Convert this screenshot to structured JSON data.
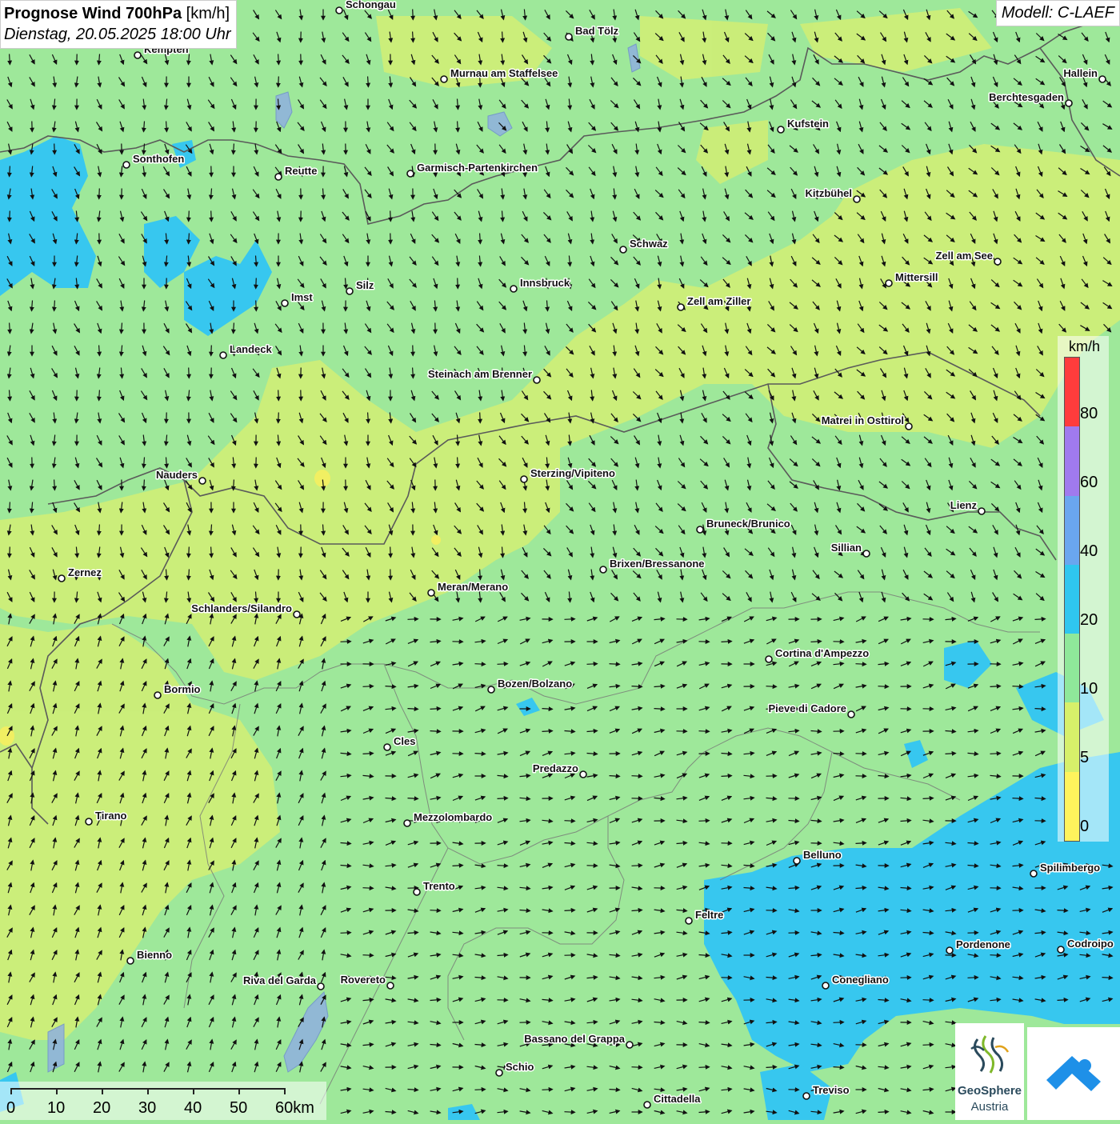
{
  "header": {
    "title_bold": "Prognose Wind 700hPa",
    "title_unit": "[km/h]",
    "date": "Dienstag, 20.05.2025 18:00 Uhr",
    "model": "Modell: C-LAEF"
  },
  "legend": {
    "unit": "km/h",
    "ticks": [
      "80",
      "60",
      "40",
      "20",
      "10",
      "5",
      "0"
    ],
    "colors": [
      "#ff3c3c",
      "#a07aee",
      "#6aa6ef",
      "#2fc6ef",
      "#8fe89a",
      "#d7f06a",
      "#fff35c"
    ]
  },
  "scale": {
    "labels": [
      "0",
      "10",
      "20",
      "30",
      "40",
      "50",
      "60km"
    ]
  },
  "logo": {
    "name_line1": "GeoSphere",
    "name_line2": "Austria",
    "icon1": "geosphere-logo",
    "icon2": "weather-app-icon"
  },
  "cities": [
    {
      "name": "Schongau"
    },
    {
      "name": "Bad Tölz"
    },
    {
      "name": "Kempten"
    },
    {
      "name": "Murnau am Staffelsee"
    },
    {
      "name": "Hallein"
    },
    {
      "name": "Berchtesgaden"
    },
    {
      "name": "Kufstein"
    },
    {
      "name": "Sonthofen"
    },
    {
      "name": "Reutte"
    },
    {
      "name": "Garmisch-Partenkirchen"
    },
    {
      "name": "Kitzbühel"
    },
    {
      "name": "Schwaz"
    },
    {
      "name": "Zell am See"
    },
    {
      "name": "Mittersill"
    },
    {
      "name": "Imst"
    },
    {
      "name": "Silz"
    },
    {
      "name": "Innsbruck"
    },
    {
      "name": "Zell am Ziller"
    },
    {
      "name": "Landeck"
    },
    {
      "name": "Steinach am Brenner"
    },
    {
      "name": "Matrei in Osttirol"
    },
    {
      "name": "Nauders"
    },
    {
      "name": "Sterzing/Vipiteno"
    },
    {
      "name": "Lienz"
    },
    {
      "name": "Bruneck/Brunico"
    },
    {
      "name": "Sillian"
    },
    {
      "name": "Zernez"
    },
    {
      "name": "Brixen/Bressanone"
    },
    {
      "name": "Meran/Merano"
    },
    {
      "name": "Schlanders/Silandro"
    },
    {
      "name": "Cortina d'Ampezzo"
    },
    {
      "name": "Bozen/Bolzano"
    },
    {
      "name": "Bormio"
    },
    {
      "name": "Pieve di Cadore"
    },
    {
      "name": "Cles"
    },
    {
      "name": "Predazzo"
    },
    {
      "name": "Tirano"
    },
    {
      "name": "Mezzolombardo"
    },
    {
      "name": "Belluno"
    },
    {
      "name": "Spilimbergo"
    },
    {
      "name": "Trento"
    },
    {
      "name": "Feltre"
    },
    {
      "name": "Bienno"
    },
    {
      "name": "Pordenone"
    },
    {
      "name": "Codroipo"
    },
    {
      "name": "Riva del Garda"
    },
    {
      "name": "Rovereto"
    },
    {
      "name": "Conegliano"
    },
    {
      "name": "Bassano del Grappa"
    },
    {
      "name": "Schio"
    },
    {
      "name": "Treviso"
    },
    {
      "name": "Cittadella"
    }
  ],
  "wind_field": {
    "dominant_direction": "north to south, curving south-east in the south",
    "speed_range_kmh": "5–20"
  }
}
